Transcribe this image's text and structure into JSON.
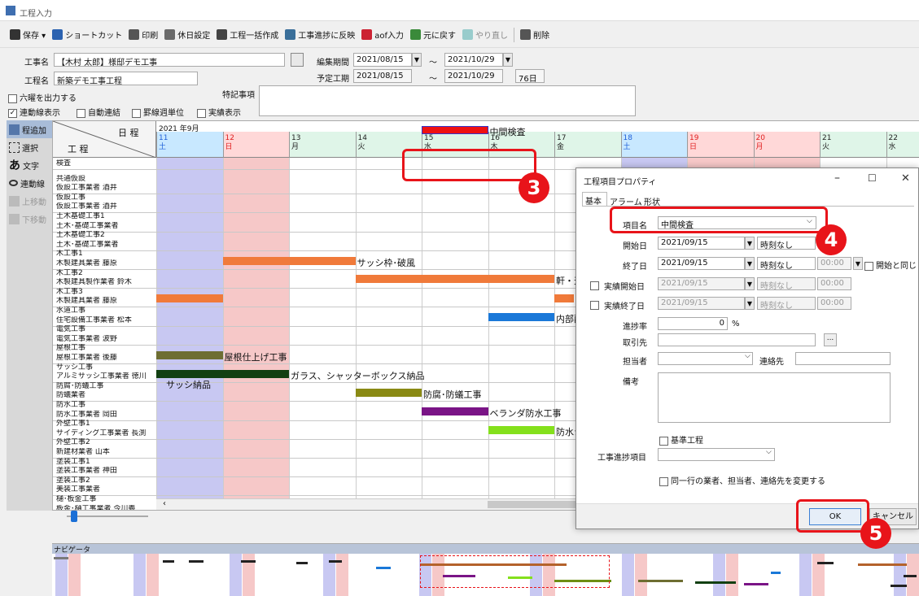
{
  "window": {
    "title": "工程入力"
  },
  "toolbar": [
    "保存 ▾",
    "ショートカット",
    "印刷",
    "休日設定",
    "工程一括作成",
    "工事進捗に反映",
    "aof入力",
    "元に戻す",
    "やり直し",
    "削除"
  ],
  "header": {
    "kouji_label": "工事名",
    "kouji_value": "【木村 太郎】様邸デモ工事",
    "henshu_label": "編集期間",
    "henshu_from": "2021/08/15",
    "henshu_to": "2021/10/29",
    "tilde": "～",
    "yotei_label": "予定工期",
    "yotei_from": "2021/08/15",
    "yotei_to": "2021/10/29",
    "yotei_days": "76日",
    "koutei_label": "工程名",
    "koutei_value": "新築デモ工事工程",
    "tokki_label": "特記事項",
    "rokuyou": "六曜を出力する",
    "renraku": "連動線表示",
    "jidou": "自動連結",
    "keisen": "罫線週単位",
    "jisseki": "実績表示"
  },
  "left_tools": [
    "程追加",
    "選択",
    "文字",
    "連動線",
    "上移動",
    "下移動"
  ],
  "grid": {
    "corner_top": "日 程",
    "corner_bottom": "工 程",
    "month": "2021 年9月",
    "days": [
      {
        "d": "11",
        "w": "土"
      },
      {
        "d": "12",
        "w": "日"
      },
      {
        "d": "13",
        "w": "月"
      },
      {
        "d": "14",
        "w": "火"
      },
      {
        "d": "15",
        "w": "水"
      },
      {
        "d": "16",
        "w": "木"
      },
      {
        "d": "17",
        "w": "金"
      },
      {
        "d": "18",
        "w": "土"
      },
      {
        "d": "19",
        "w": "日"
      },
      {
        "d": "20",
        "w": "月"
      },
      {
        "d": "21",
        "w": "火"
      },
      {
        "d": "22",
        "w": "水"
      }
    ],
    "rows": [
      "検査",
      "共通仮設",
      "仮設工事業者 酒井",
      "仮設工事",
      "仮設工事業者 酒井",
      "土木基礎工事1",
      "土木･基礎工事業者",
      "土木基礎工事2",
      "土木･基礎工事業者",
      "木工事1",
      "木製建具業者 藤原",
      "木工事2",
      "木製建具製作業者 鈴木",
      "木工事3",
      "木製建具業者 藤原",
      "水道工事",
      "住宅設備工事業者 松本",
      "電気工事",
      "電気工事業者 波野",
      "屋根工事",
      "屋根工事業者 後藤",
      "サッシ工事",
      "アルミサッシ工事業者 徳川",
      "防腐･防蟻工事",
      "防蟻業者",
      "防水工事",
      "防水工事業者 岡田",
      "外壁工事1",
      "サイディング工事業者 長渕",
      "外壁工事2",
      "新建材業者 山本",
      "塗装工事1",
      "塗装工事業者 神田",
      "塗装工事2",
      "美装工事業者",
      "樋･板金工事",
      "板金･樋工事業者 今川義"
    ],
    "bars": [
      "中間検査",
      "サッシ枠･破風",
      "軒・天",
      "内部配",
      "屋根仕上げ工事",
      "ガラス、シャッターボックス納品",
      "サッシ納品",
      "防腐･防蟻工事",
      "ベランダ防水工事",
      "防水シ"
    ]
  },
  "navigator": {
    "title": "ナビゲータ"
  },
  "dialog": {
    "title": "工程項目プロパティ",
    "tabs": [
      "基本",
      "アラーム",
      "形状"
    ],
    "item_label": "項目名",
    "item_value": "中間検査",
    "start_label": "開始日",
    "start_value": "2021/09/15",
    "time_none": "時刻なし",
    "end_label": "終了日",
    "end_value": "2021/09/15",
    "time_zero": "00:00",
    "same_start": "開始と同じ",
    "jstart_label": "実績開始日",
    "jstart_value": "2021/09/15",
    "jend_label": "実績終了日",
    "jend_value": "2021/09/15",
    "progress_label": "進捗率",
    "progress_value": "0",
    "percent": "%",
    "client_label": "取引先",
    "client_btn": "...",
    "person_label": "担当者",
    "contact_label": "連絡先",
    "note_label": "備考",
    "base_label": "基準工程",
    "progress_item_label": "工事進捗項目",
    "same_row_label": "同一行の業者、担当者、連絡先を変更する",
    "ok": "OK",
    "cancel": "キャンセル"
  },
  "badges": [
    "3",
    "4",
    "5"
  ],
  "colors": {
    "accent": "#e8141a",
    "orange": "#f07a3a",
    "red_bar": "#ee1111",
    "blue_bar": "#1a78d8",
    "olive": "#6e6e32",
    "dkgreen": "#124012",
    "olive2": "#8a8a14",
    "purple": "#7a1486",
    "lime": "#84e01c"
  }
}
